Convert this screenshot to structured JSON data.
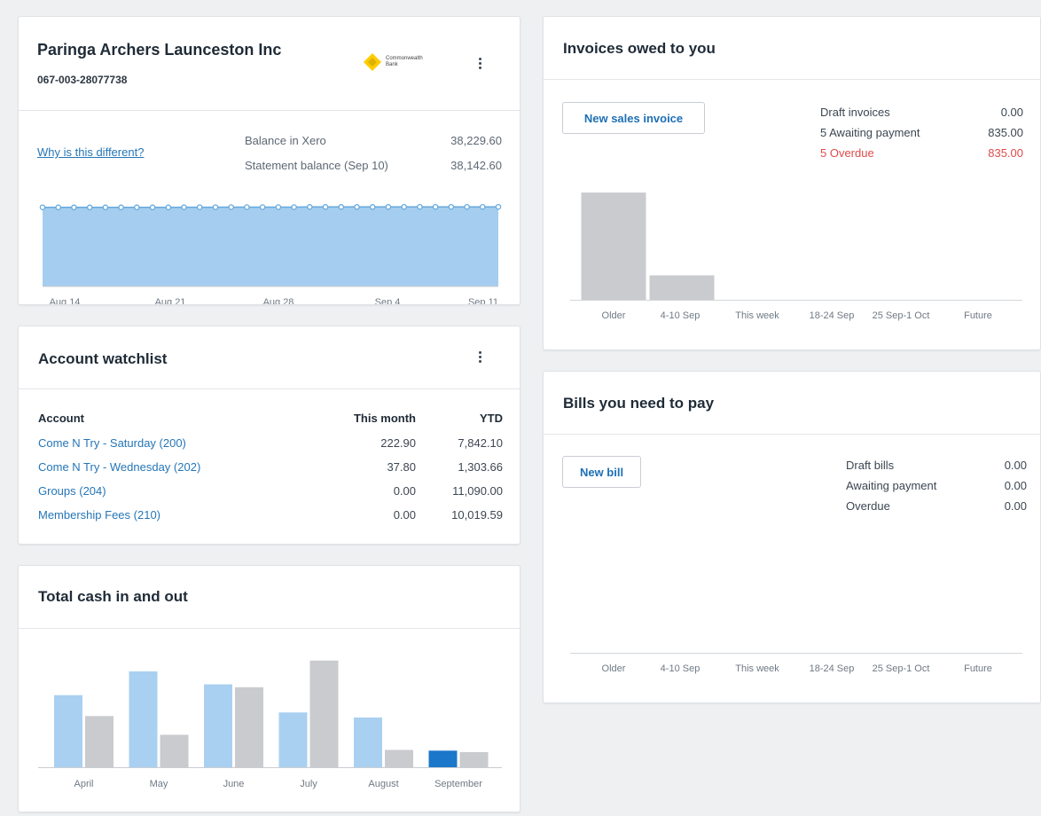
{
  "bank": {
    "name": "Paringa Archers Launceston Inc",
    "account_number": "067-003-28077738",
    "logo_text": "Commonwealth Bank",
    "why_link": "Why is this different?",
    "balance_label": "Balance in Xero",
    "balance_value": "38,229.60",
    "statement_label": "Statement balance (Sep 10)",
    "statement_value": "38,142.60",
    "chart_data": {
      "type": "area",
      "x_ticks": [
        "Aug 14",
        "Aug 21",
        "Aug 28",
        "Sep 4",
        "Sep 11"
      ],
      "ylim": [
        0,
        40000
      ],
      "values": [
        38000,
        37950,
        37950,
        37950,
        37950,
        37950,
        37950,
        37950,
        37950,
        38050,
        38050,
        38050,
        38100,
        38100,
        38100,
        38100,
        38100,
        38150,
        38150,
        38150,
        38150,
        38150,
        38150,
        38200,
        38200,
        38200,
        38200,
        38200,
        38200,
        38229.6
      ],
      "colors": {
        "fill": "#a5cdef",
        "line": "#66a9de"
      }
    }
  },
  "watchlist": {
    "title": "Account watchlist",
    "headers": {
      "account": "Account",
      "month": "This month",
      "ytd": "YTD"
    },
    "rows": [
      {
        "account": "Come N Try - Saturday (200)",
        "month": "222.90",
        "ytd": "7,842.10"
      },
      {
        "account": "Come N Try - Wednesday (202)",
        "month": "37.80",
        "ytd": "1,303.66"
      },
      {
        "account": "Groups (204)",
        "month": "0.00",
        "ytd": "11,090.00"
      },
      {
        "account": "Membership Fees (210)",
        "month": "0.00",
        "ytd": "10,019.59"
      }
    ]
  },
  "cash": {
    "title": "Total cash in and out",
    "chart_data": {
      "type": "bar",
      "categories": [
        "April",
        "May",
        "June",
        "July",
        "August",
        "September"
      ],
      "series": [
        {
          "values": [
            1000,
            1330,
            1150,
            760,
            690,
            230
          ]
        },
        {
          "values": [
            710,
            450,
            1110,
            1480,
            240,
            210
          ]
        }
      ],
      "ylim": [
        0,
        1600
      ],
      "colors": {
        "in": "#a9d0f1",
        "out": "#c9cbce",
        "current_in": "#1a77c9"
      }
    }
  },
  "invoices": {
    "title": "Invoices owed to you",
    "button": "New sales invoice",
    "summary": [
      {
        "label": "Draft invoices",
        "value": "0.00",
        "overdue": false
      },
      {
        "label": "5 Awaiting payment",
        "value": "835.00",
        "overdue": false
      },
      {
        "label": "5 Overdue",
        "value": "835.00",
        "overdue": true
      }
    ],
    "chart_data": {
      "type": "bar",
      "categories": [
        "Older",
        "4-10 Sep",
        "This week",
        "18-24 Sep",
        "25 Sep-1 Oct",
        "Future"
      ],
      "values": [
        680,
        155,
        0,
        0,
        0,
        0
      ],
      "ylim": [
        0,
        720
      ],
      "colors": {
        "bar": "#c9cbce",
        "overdue": "#e04a4a"
      }
    }
  },
  "bills": {
    "title": "Bills you need to pay",
    "button": "New bill",
    "summary": [
      {
        "label": "Draft bills",
        "value": "0.00"
      },
      {
        "label": "Awaiting payment",
        "value": "0.00"
      },
      {
        "label": "Overdue",
        "value": "0.00"
      }
    ],
    "chart_data": {
      "type": "bar",
      "categories": [
        "Older",
        "4-10 Sep",
        "This week",
        "18-24 Sep",
        "25 Sep-1 Oct",
        "Future"
      ],
      "values": [
        0,
        0,
        0,
        0,
        0,
        0
      ]
    }
  }
}
